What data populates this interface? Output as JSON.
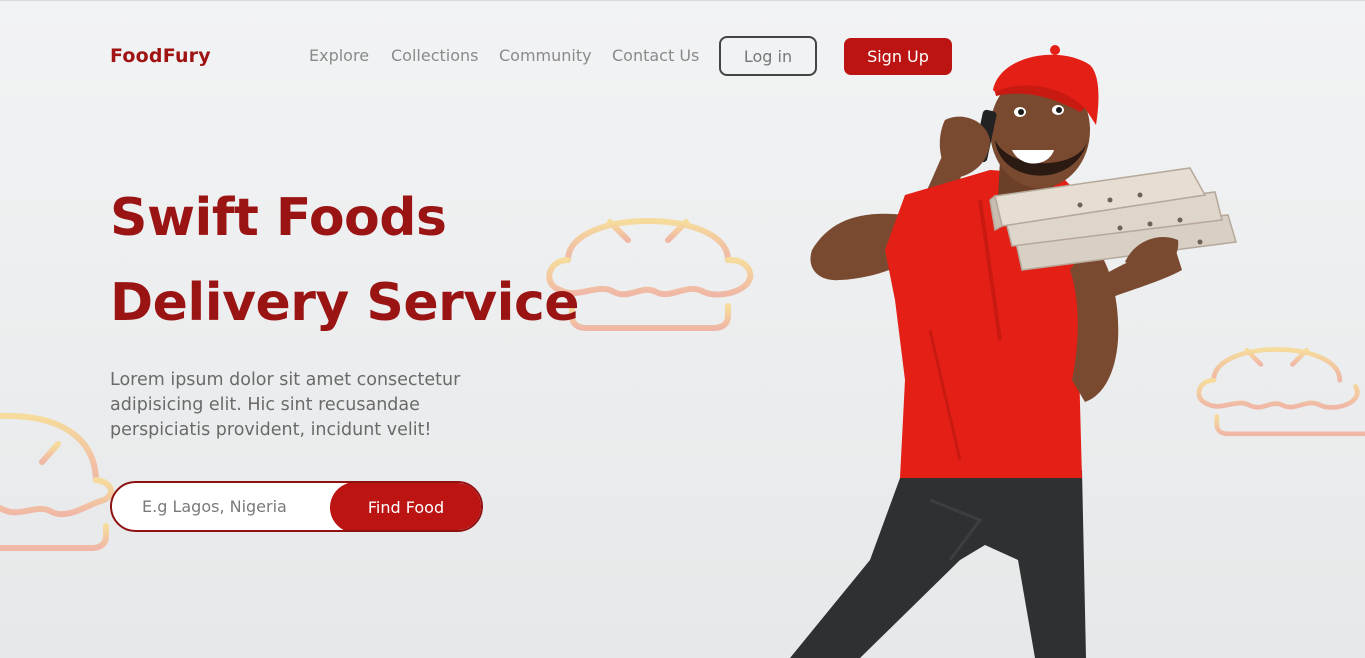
{
  "header": {
    "logo": "FoodFury",
    "nav": [
      "Explore",
      "Collections",
      "Community",
      "Contact Us"
    ],
    "login_label": "Log in",
    "signup_label": "Sign Up"
  },
  "hero": {
    "title_line1": "Swift Foods",
    "title_line2": "Delivery Service",
    "description": "Lorem ipsum dolor sit amet consectetur adipisicing elit. Hic sint recusandae perspiciatis provident, incidunt velit!",
    "search_placeholder": "E.g Lagos, Nigeria",
    "find_label": "Find Food"
  },
  "colors": {
    "brand": "#9a1414",
    "button": "#bb1412",
    "shirt": "#e41f16"
  },
  "icons": [
    "burger-icon",
    "burger-icon",
    "burger-icon"
  ]
}
